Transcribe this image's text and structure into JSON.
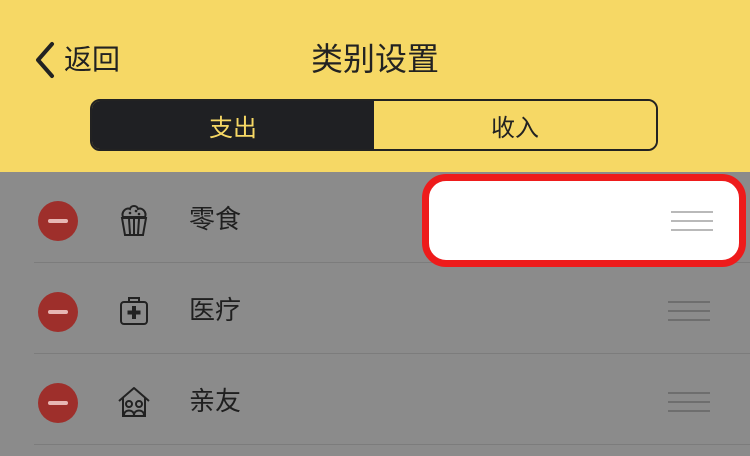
{
  "header": {
    "back_label": "返回",
    "title": "类别设置",
    "tabs": [
      {
        "label": "支出",
        "active": true
      },
      {
        "label": "收入",
        "active": false
      }
    ],
    "background": "#f6d865"
  },
  "categories": [
    {
      "label": "零食",
      "icon": "cupcake-icon"
    },
    {
      "label": "医疗",
      "icon": "medical-kit-icon"
    },
    {
      "label": "亲友",
      "icon": "house-people-icon"
    }
  ],
  "colors": {
    "accent_dark": "#1f2023",
    "delete_red": "#9e2f2b",
    "highlight_red": "#ee1b1b",
    "overlay_gray": "#8b8b8b"
  }
}
